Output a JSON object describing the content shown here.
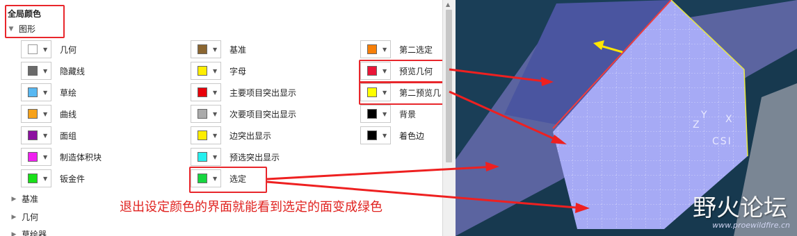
{
  "tree": {
    "title": "全局颜色",
    "group": "图形",
    "collapsed_sections": [
      "基准",
      "几何",
      "草绘器"
    ]
  },
  "colors": {
    "col1": [
      {
        "label": "几何",
        "color": "#ffffff"
      },
      {
        "label": "隐藏线",
        "color": "#6a6a6a"
      },
      {
        "label": "草绘",
        "color": "#58b8f2"
      },
      {
        "label": "曲线",
        "color": "#f7a21a"
      },
      {
        "label": "面组",
        "color": "#8c10a0"
      },
      {
        "label": "制造体积块",
        "color": "#f020f0"
      },
      {
        "label": "钣金件",
        "color": "#19e019"
      }
    ],
    "col2": [
      {
        "label": "基准",
        "color": "#8b6631"
      },
      {
        "label": "字母",
        "color": "#ffee00"
      },
      {
        "label": "主要项目突出显示",
        "color": "#e8000a"
      },
      {
        "label": "次要项目突出显示",
        "color": "#ababab"
      },
      {
        "label": "边突出显示",
        "color": "#ffee00"
      },
      {
        "label": "预选突出显示",
        "color": "#25f0ef"
      },
      {
        "label": "选定",
        "color": "#16d640"
      }
    ],
    "col3": [
      {
        "label": "第二选定",
        "color": "#f77f08"
      },
      {
        "label": "预览几何",
        "color": "#ea1538"
      },
      {
        "label": "第二预览几",
        "color": "#ffff00"
      },
      {
        "label": "背景",
        "color": "#000000"
      },
      {
        "label": "着色边",
        "color": "#000000"
      }
    ]
  },
  "annotation": "退出设定颜色的界面就能看到选定的面变成绿色",
  "viewport": {
    "csi_y": "Y",
    "csi_z": "Z",
    "csi_x": "X",
    "csi_label": "CSI",
    "watermark": "野火论坛",
    "watermark_url": "www.proewildfire.cn"
  }
}
